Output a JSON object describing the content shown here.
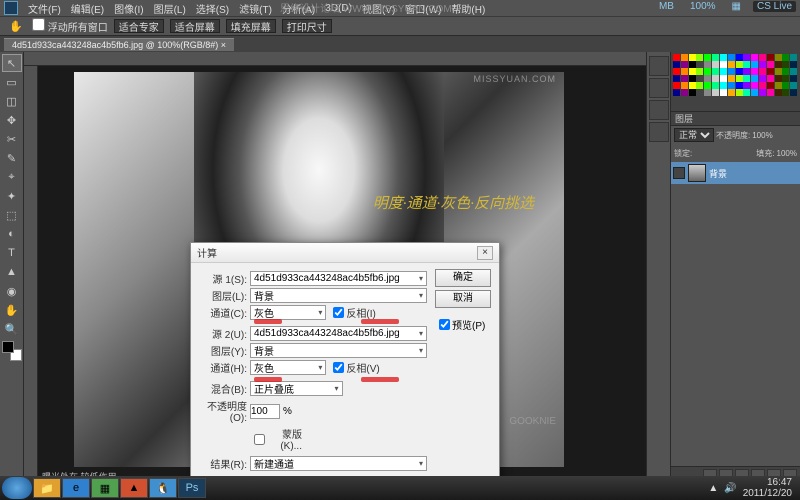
{
  "watermark_top": "思缘设计论坛 WWW.MISSYUAN.COM",
  "menu": [
    "文件(F)",
    "编辑(E)",
    "图像(I)",
    "图层(L)",
    "选择(S)",
    "滤镜(T)",
    "分析(A)",
    "3D(D)",
    "视图(V)",
    "窗口(W)",
    "帮助(H)"
  ],
  "top_right": {
    "mb": "MB",
    "zoom": "100%",
    "view": "▦",
    "cslive": "CS Live"
  },
  "options": {
    "float": "浮动所有窗口",
    "fit1": "适合专家",
    "fit2": "适合屏幕",
    "fit3": "填充屏幕",
    "print": "打印尺寸"
  },
  "tab": "4d51d933ca443248ac4b5fb6.jpg @ 100%(RGB/8#) ×",
  "tools_icons": [
    "↖",
    "▭",
    "◫",
    "✥",
    "✂",
    "✎",
    "⌖",
    "✦",
    "⬚",
    "◐",
    "T",
    "▲",
    "◉",
    "✋",
    "🔍"
  ],
  "overlay": "明度·通道·灰色·反向挑选",
  "status": "曝光处在 较低作用",
  "watermark_img": "GOOKNIE",
  "layers": {
    "panel_title": "图层",
    "blend": "正常",
    "opacity_label": "不透明度:",
    "opacity": "100%",
    "lock_label": "锁定:",
    "fill_label": "填充:",
    "fill": "100%",
    "bg_layer": "背景"
  },
  "dialog": {
    "title": "计算",
    "src1": "源 1(S):",
    "src1_val": "4d51d933ca443248ac4b5fb6.jpg",
    "layer1": "图层(L):",
    "layer1_val": "背景",
    "chan1": "通道(C):",
    "chan1_val": "灰色",
    "invert1": "反相(I)",
    "src2": "源 2(U):",
    "src2_val": "4d51d933ca443248ac4b5fb6.jpg",
    "layer2": "图层(Y):",
    "layer2_val": "背景",
    "chan2": "通道(H):",
    "chan2_val": "灰色",
    "invert2": "反相(V)",
    "blend": "混合(B):",
    "blend_val": "正片叠底",
    "opacity": "不透明度(O):",
    "opacity_val": "100",
    "pct": "%",
    "mask": "蒙版(K)...",
    "result": "结果(R):",
    "result_val": "新建通道",
    "ok": "确定",
    "cancel": "取消",
    "preview": "预览(P)"
  },
  "taskbar_time": "16:47",
  "taskbar_date": "2011/12/20"
}
